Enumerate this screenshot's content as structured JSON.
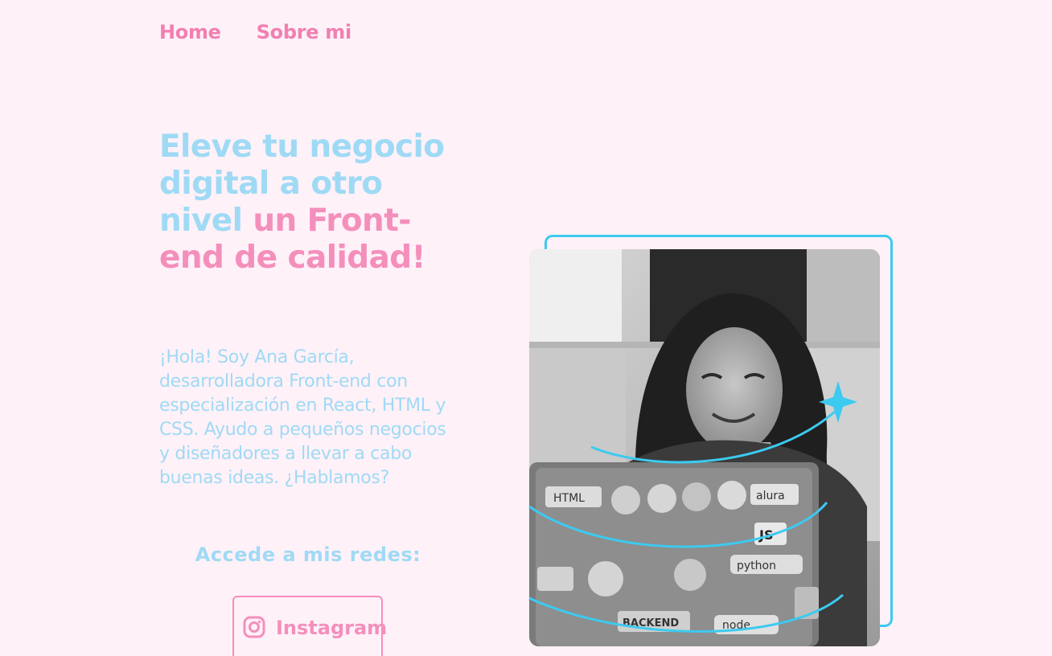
{
  "nav": {
    "items": [
      {
        "label": "Home"
      },
      {
        "label": "Sobre mi"
      }
    ]
  },
  "hero": {
    "headline_blue": "Eleve tu negocio digital a otro nivel",
    "headline_pink": "un Front-end de calidad!",
    "intro": "¡Hola! Soy Ana García, desarrolladora Front-end con especialización en React, HTML y CSS. Ayudo a pequeños negocios y diseñadores a llevar a cabo buenas ideas. ¿Hablamos?",
    "social_title": "Accede a mis redes:",
    "instagram_label": "Instagram",
    "instagram_icon": "instagram-icon"
  },
  "photo": {
    "description_icon": "profile-photo",
    "sticker_texts": [
      "HTML",
      "alura",
      "JS",
      "python",
      "BACKEND",
      "node"
    ]
  },
  "colors": {
    "background": "#fff1f8",
    "pink": "#f48fbc",
    "blue": "#9fdaf5",
    "accent_cyan": "#3ccaf0"
  }
}
